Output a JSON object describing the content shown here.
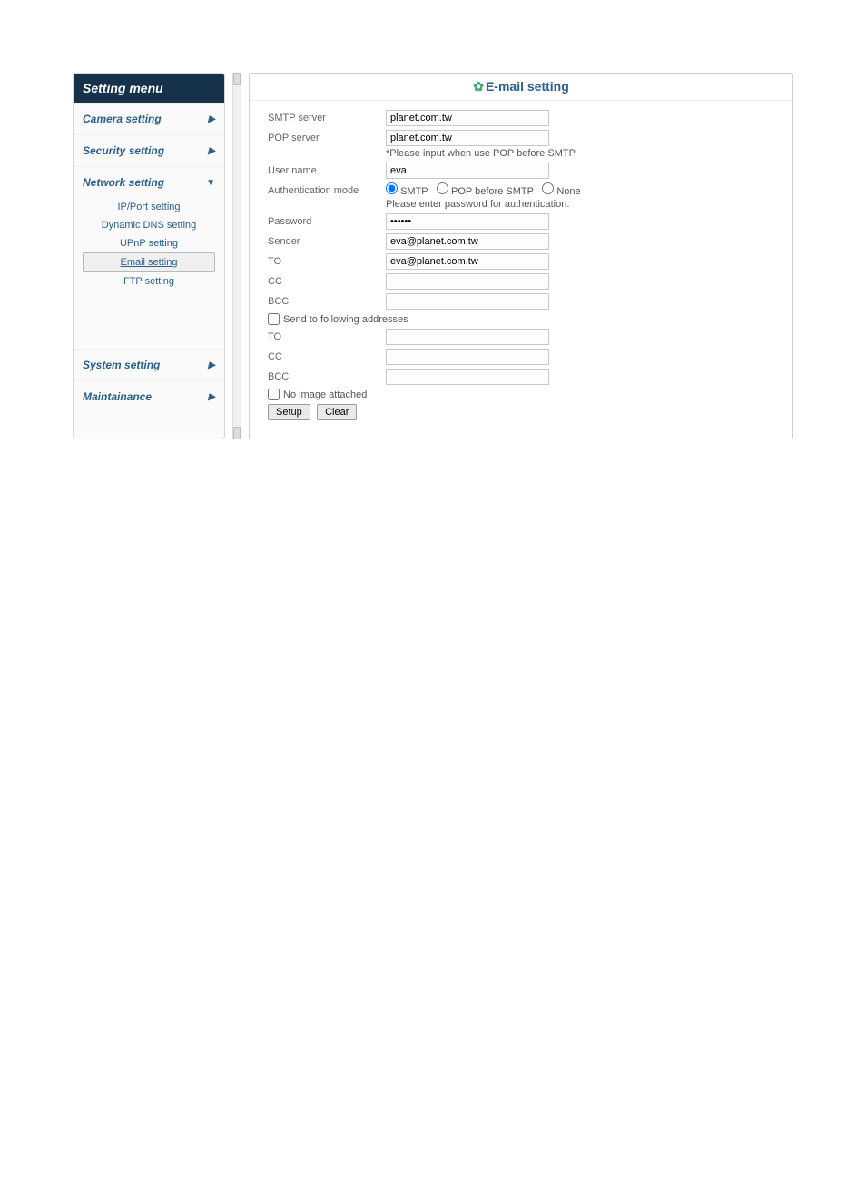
{
  "sidebar": {
    "title": "Setting menu",
    "items": [
      {
        "label": "Camera setting",
        "expanded": false
      },
      {
        "label": "Security setting",
        "expanded": false
      },
      {
        "label": "Network setting",
        "expanded": true
      },
      {
        "label": "System setting",
        "expanded": false
      },
      {
        "label": "Maintainance",
        "expanded": false
      }
    ],
    "network_sub": [
      "IP/Port setting",
      "Dynamic DNS setting",
      "UPnP setting",
      "Email setting",
      "FTP setting"
    ]
  },
  "panel": {
    "title": "E-mail setting",
    "smtp_label": "SMTP server",
    "smtp_value": "planet.com.tw",
    "pop_label": "POP server",
    "pop_value": "planet.com.tw",
    "pop_note": "*Please input when use POP before SMTP",
    "user_label": "User name",
    "user_value": "eva",
    "auth_label": "Authentication mode",
    "auth_opts": [
      "SMTP",
      "POP before SMTP",
      "None"
    ],
    "auth_note": "Please enter password for authentication.",
    "pwd_label": "Password",
    "pwd_value": "••••••",
    "sender_label": "Sender",
    "sender_value": "eva@planet.com.tw",
    "to1_label": "TO",
    "to1_value": "eva@planet.com.tw",
    "cc1_label": "CC",
    "bcc1_label": "BCC",
    "send_following": "Send to following addresses",
    "to2_label": "TO",
    "cc2_label": "CC",
    "bcc2_label": "BCC",
    "no_image": "No image attached",
    "btn_setup": "Setup",
    "btn_clear": "Clear"
  }
}
